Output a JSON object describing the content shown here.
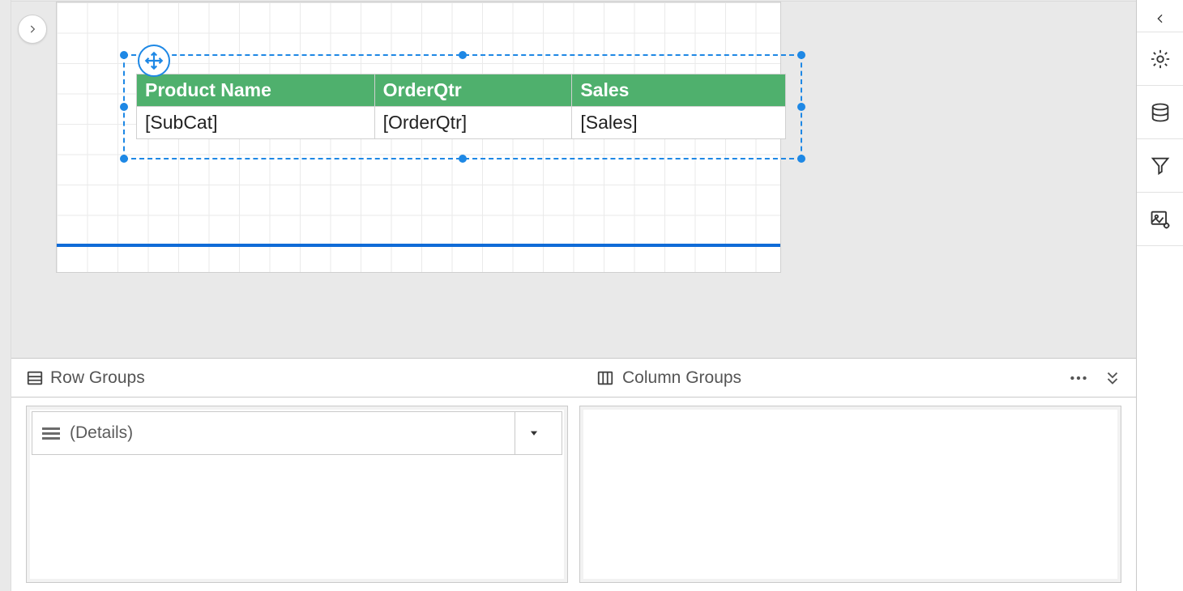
{
  "tablix": {
    "headers": [
      "Product Name",
      "OrderQtr",
      "Sales"
    ],
    "row": [
      "[SubCat]",
      "[OrderQtr]",
      "[Sales]"
    ]
  },
  "grouping": {
    "row_groups_label": "Row Groups",
    "column_groups_label": "Column Groups",
    "details_label": "(Details)"
  },
  "icons": {
    "expand": "chevron-right",
    "collapse_rail": "chevron-left",
    "settings": "gear",
    "data": "database",
    "filter": "funnel",
    "image": "image-settings",
    "more": "ellipsis",
    "collapse_pane": "double-chevron-down"
  }
}
